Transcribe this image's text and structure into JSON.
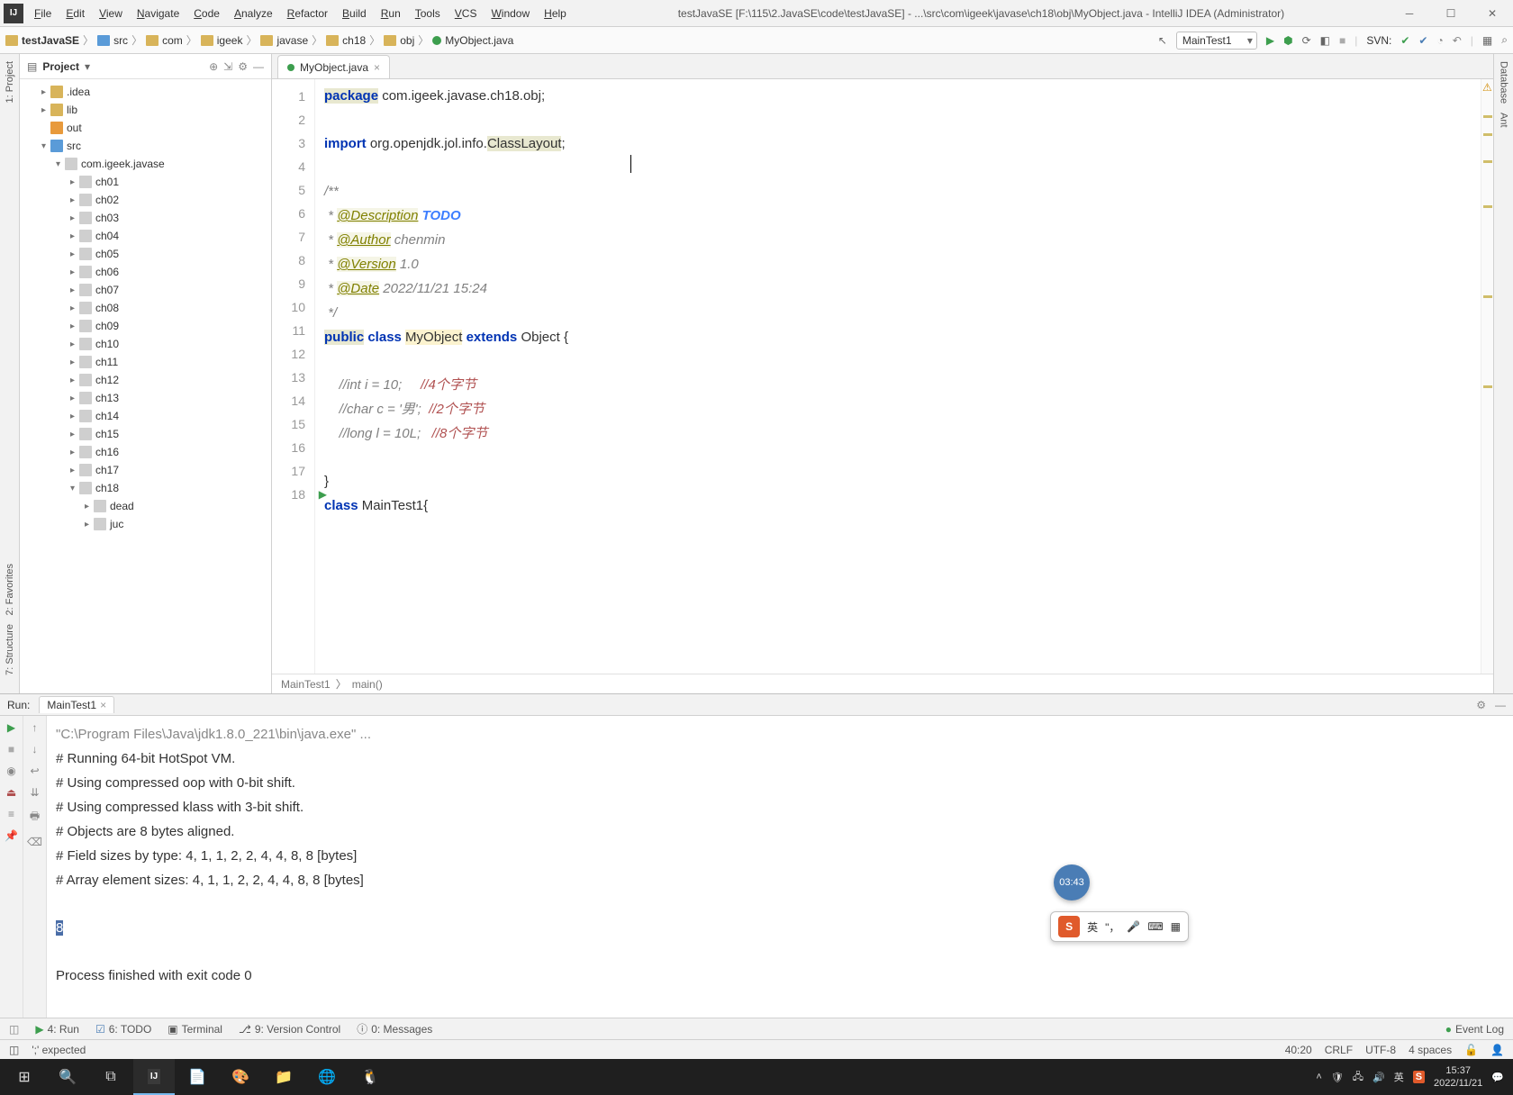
{
  "window": {
    "title": "testJavaSE [F:\\115\\2.JavaSE\\code\\testJavaSE] - ...\\src\\com\\igeek\\javase\\ch18\\obj\\MyObject.java - IntelliJ IDEA (Administrator)"
  },
  "menu": [
    "File",
    "Edit",
    "View",
    "Navigate",
    "Code",
    "Analyze",
    "Refactor",
    "Build",
    "Run",
    "Tools",
    "VCS",
    "Window",
    "Help"
  ],
  "breadcrumb": [
    "testJavaSE",
    "src",
    "com",
    "igeek",
    "javase",
    "ch18",
    "obj",
    "MyObject.java"
  ],
  "runConfig": {
    "selected": "MainTest1",
    "svn": "SVN:"
  },
  "project": {
    "title": "Project",
    "tree": [
      {
        "d": 1,
        "ic": "folder",
        "label": ".idea",
        "arrow": ">"
      },
      {
        "d": 1,
        "ic": "folder",
        "label": "lib",
        "arrow": ">"
      },
      {
        "d": 1,
        "ic": "folder orange",
        "label": "out",
        "arrow": ""
      },
      {
        "d": 1,
        "ic": "folder blue",
        "label": "src",
        "arrow": "v"
      },
      {
        "d": 2,
        "ic": "pkg",
        "label": "com.igeek.javase",
        "arrow": "v"
      },
      {
        "d": 3,
        "ic": "pkg",
        "label": "ch01",
        "arrow": ">"
      },
      {
        "d": 3,
        "ic": "pkg",
        "label": "ch02",
        "arrow": ">"
      },
      {
        "d": 3,
        "ic": "pkg",
        "label": "ch03",
        "arrow": ">"
      },
      {
        "d": 3,
        "ic": "pkg",
        "label": "ch04",
        "arrow": ">"
      },
      {
        "d": 3,
        "ic": "pkg",
        "label": "ch05",
        "arrow": ">"
      },
      {
        "d": 3,
        "ic": "pkg",
        "label": "ch06",
        "arrow": ">"
      },
      {
        "d": 3,
        "ic": "pkg",
        "label": "ch07",
        "arrow": ">"
      },
      {
        "d": 3,
        "ic": "pkg",
        "label": "ch08",
        "arrow": ">"
      },
      {
        "d": 3,
        "ic": "pkg",
        "label": "ch09",
        "arrow": ">"
      },
      {
        "d": 3,
        "ic": "pkg",
        "label": "ch10",
        "arrow": ">"
      },
      {
        "d": 3,
        "ic": "pkg",
        "label": "ch11",
        "arrow": ">"
      },
      {
        "d": 3,
        "ic": "pkg",
        "label": "ch12",
        "arrow": ">"
      },
      {
        "d": 3,
        "ic": "pkg",
        "label": "ch13",
        "arrow": ">"
      },
      {
        "d": 3,
        "ic": "pkg",
        "label": "ch14",
        "arrow": ">"
      },
      {
        "d": 3,
        "ic": "pkg",
        "label": "ch15",
        "arrow": ">"
      },
      {
        "d": 3,
        "ic": "pkg",
        "label": "ch16",
        "arrow": ">"
      },
      {
        "d": 3,
        "ic": "pkg",
        "label": "ch17",
        "arrow": ">"
      },
      {
        "d": 3,
        "ic": "pkg",
        "label": "ch18",
        "arrow": "v"
      },
      {
        "d": 4,
        "ic": "pkg",
        "label": "dead",
        "arrow": ">"
      },
      {
        "d": 4,
        "ic": "pkg",
        "label": "juc",
        "arrow": ">"
      }
    ]
  },
  "leftTabs": [
    "1: Project",
    "2: Favorites",
    "7: Structure"
  ],
  "rightTabs": [
    "Database",
    "Ant"
  ],
  "editor": {
    "tab": "MyObject.java",
    "lines": 18,
    "crumb": [
      "MainTest1",
      "main()"
    ],
    "code": {
      "l1_pkg": "package",
      "l1_rest": " com.igeek.javase.ch18.obj;",
      "l3_imp": "import",
      "l3_rest1": " org.openjdk.jol.info.",
      "l3_cls": "ClassLayout",
      "l3_semi": ";",
      "l5": "/**",
      "l6a": " * ",
      "l6b": "@Description",
      "l6c": " TODO",
      "l7a": " * ",
      "l7b": "@Author",
      "l7c": " chenmin",
      "l8a": " * ",
      "l8b": "@Version",
      "l8c": " 1.0",
      "l9a": " * ",
      "l9b": "@Date",
      "l9c": " 2022/11/21 15:24",
      "l10": " */",
      "l11a": "public",
      "l11b": " class ",
      "l11c": "MyObject",
      "l11d": " extends ",
      "l11e": "Object {",
      "l13a": "    //int i = 10;     ",
      "l13b": "//4个字节",
      "l14a": "    //char c = '男';  ",
      "l14b": "//2个字节",
      "l15a": "    //long l = 10L;   ",
      "l15b": "//8个字节",
      "l17": "}",
      "l18a": "class ",
      "l18b": "MainTest1{"
    }
  },
  "run": {
    "label": "Run:",
    "tab": "MainTest1",
    "out": {
      "cmd": "\"C:\\Program Files\\Java\\jdk1.8.0_221\\bin\\java.exe\" ...",
      "l2": "# Running 64-bit HotSpot VM.",
      "l3": "# Using compressed oop with 0-bit shift.",
      "l4": "# Using compressed klass with 3-bit shift.",
      "l5": "# Objects are 8 bytes aligned.",
      "l6": "# Field sizes by type: 4, 1, 1, 2, 2, 4, 4, 8, 8 [bytes]",
      "l7": "# Array element sizes: 4, 1, 1, 2, 2, 4, 4, 8, 8 [bytes]",
      "sel": "8",
      "exit": "Process finished with exit code 0"
    }
  },
  "bottomTools": [
    "4: Run",
    "6: TODO",
    "Terminal",
    "9: Version Control",
    "0: Messages"
  ],
  "bottomRight": "Event Log",
  "status": {
    "left": "';' expected",
    "pos": "40:20",
    "sep": "CRLF",
    "enc": "UTF-8",
    "indent": "4 spaces"
  },
  "timer": "03:43",
  "ime": {
    "lang": "英"
  },
  "taskbar": {
    "clock": {
      "time": "15:37",
      "date": "2022/11/21"
    },
    "tray_lang": "英"
  }
}
